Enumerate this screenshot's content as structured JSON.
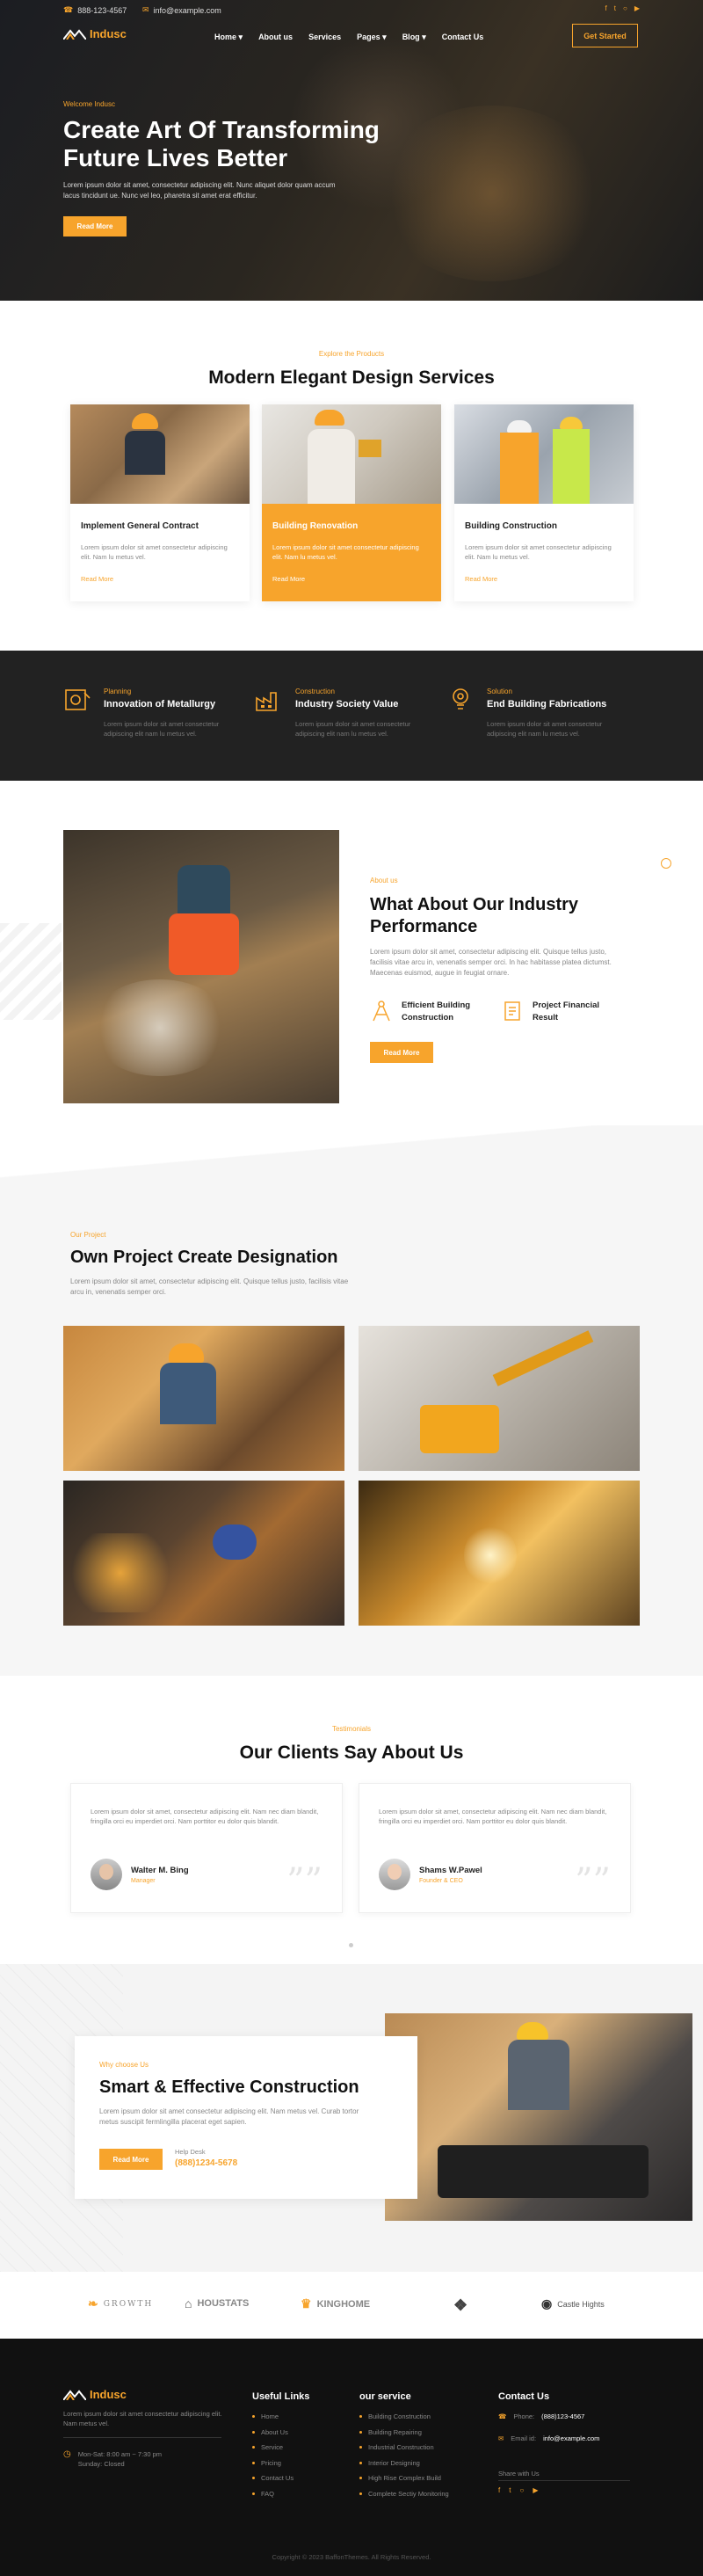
{
  "topbar": {
    "phone": "888-123-4567",
    "email": "info@example.com"
  },
  "brand": {
    "name": "Indusc"
  },
  "nav": {
    "items": [
      "Home",
      "About us",
      "Services",
      "Pages",
      "Blog",
      "Contact Us"
    ],
    "cta": "Get Started"
  },
  "hero": {
    "kicker": "Welcome Indusc",
    "title": "Create Art Of Transforming Future Lives Better",
    "text": "Lorem ipsum dolor sit amet, consectetur adipiscing elit. Nunc aliquet dolor quam accum lacus tincidunt ue. Nunc vel leo, pharetra sit amet erat efficitur.",
    "button": "Read More"
  },
  "services": {
    "kicker": "Explore the Products",
    "title": "Modern Elegant Design Services",
    "cards": [
      {
        "title": "Implement General Contract",
        "text": "Lorem ipsum dolor sit amet consectetur adipiscing elit. Nam lu metus vel.",
        "link": "Read More"
      },
      {
        "title": "Building Renovation",
        "text": "Lorem ipsum dolor sit amet consectetur adipiscing elit. Nam lu metus vel.",
        "link": "Read More"
      },
      {
        "title": "Building Construction",
        "text": "Lorem ipsum dolor sit amet consectetur adipiscing elit. Nam lu metus vel.",
        "link": "Read More"
      }
    ]
  },
  "features": [
    {
      "kicker": "Planning",
      "title": "Innovation of Metallurgy",
      "text": "Lorem ipsum dolor sit amet consectetur adipiscing elit nam lu metus vel."
    },
    {
      "kicker": "Construction",
      "title": "Industry Society Value",
      "text": "Lorem ipsum dolor sit amet consectetur adipiscing elit nam lu metus vel."
    },
    {
      "kicker": "Solution",
      "title": "End Building Fabrications",
      "text": "Lorem ipsum dolor sit amet consectetur adipiscing elit nam lu metus vel."
    }
  ],
  "about": {
    "kicker": "About us",
    "title": "What About Our Industry Performance",
    "text": "Lorem ipsum dolor sit amet, consectetur adipiscing elit. Quisque tellus justo, facilisis vitae arcu in, venenatis semper orci. In hac habitasse platea dictumst. Maecenas euismod, augue in feugiat ornare.",
    "items": [
      "Efficient Building Construction",
      "Project Financial Result"
    ],
    "button": "Read More"
  },
  "project": {
    "kicker": "Our Project",
    "title": "Own Project Create Designation",
    "text": "Lorem ipsum dolor sit amet, consectetur adipiscing elit. Quisque tellus justo, facilisis vitae arcu in, venenatis semper orci."
  },
  "testimonials": {
    "kicker": "Testimonials",
    "title": "Our Clients Say About Us",
    "items": [
      {
        "quote": "Lorem ipsum dolor sit amet, consectetur adipiscing elit. Nam nec diam blandit, fringilla orci eu imperdiet orci. Nam porttitor eu dolor quis blandit.",
        "name": "Walter M. Bing",
        "role": "Manager"
      },
      {
        "quote": "Lorem ipsum dolor sit amet, consectetur adipiscing elit. Nam nec diam blandit, fringilla orci eu imperdiet orci. Nam porttitor eu dolor quis blandit.",
        "name": "Shams W.Pawel",
        "role": "Founder & CEO"
      }
    ]
  },
  "smart": {
    "kicker": "Why choose Us",
    "title": "Smart & Effective Construction",
    "text": "Lorem ipsum dolor sit amet consectetur adipiscing elit. Nam metus vel. Curab tortor metus suscipit fermlingilla placerat eget sapien.",
    "button": "Read More",
    "help_label": "Help Desk",
    "help_phone": "(888)1234-5678"
  },
  "brands": [
    "GROWTH",
    "HOUSTATS",
    "KINGHOME",
    "Castle Hights"
  ],
  "footer": {
    "about": "Lorem ipsum dolor sit amet consectetur adipiscing elit. Nam metus vel.",
    "hours": "Mon-Sat: 8:00 am ~ 7:30 pm",
    "closed": "Sunday: Closed",
    "useful_title": "Useful Links",
    "useful": [
      "Home",
      "About Us",
      "Service",
      "Pricing",
      "Contact Us",
      "FAQ"
    ],
    "service_title": "our service",
    "service": [
      "Building Construction",
      "Building Repairing",
      "Industrial Construction",
      "Interior Designing",
      "High Rise Complex Build",
      "Complete Sectiy Monitoring"
    ],
    "contact_title": "Contact Us",
    "phone_label": "Phone:",
    "phone": "(888)123-4567",
    "email_label": "Email id:",
    "email": "info@example.com",
    "share": "Share with Us",
    "copyright": "Copyright © 2023 BaffonThemes. All Rights Reserved."
  },
  "colors": {
    "accent": "#f7a42c",
    "dark": "#222222"
  }
}
